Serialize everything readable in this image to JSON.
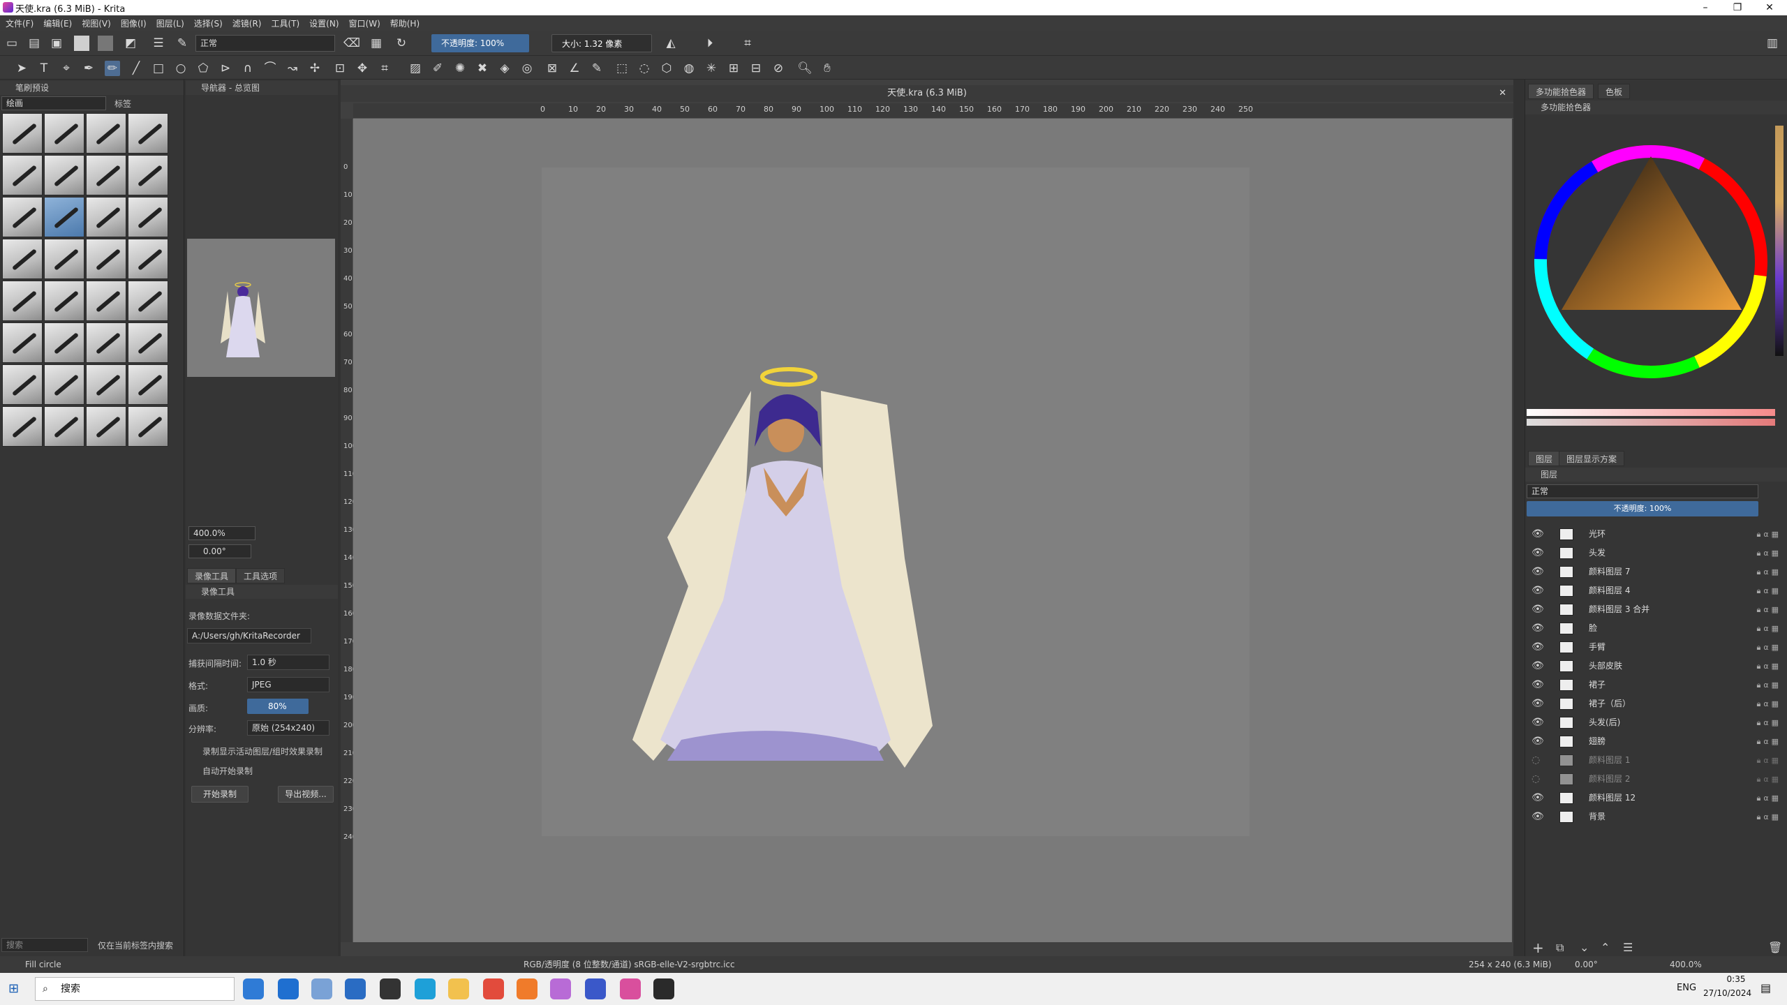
{
  "window": {
    "title": "天使.kra (6.3 MiB) - Krita"
  },
  "menu": [
    "文件(F)",
    "编辑(E)",
    "视图(V)",
    "图像(I)",
    "图层(L)",
    "选择(S)",
    "滤镜(R)",
    "工具(T)",
    "设置(N)",
    "窗口(W)",
    "帮助(H)"
  ],
  "toolbar": {
    "blend_mode": "正常",
    "opacity_label": "不透明度: 100%",
    "size_label": "大小: 1.32 像素"
  },
  "brush_presets": {
    "title": "笔刷预设",
    "filter": "绘画",
    "tag_label": "标签",
    "search_placeholder": "搜索",
    "search_in_tag": "仅在当前标签内搜索"
  },
  "navigator": {
    "title": "导航器 - 总览图",
    "zoom": "400.0%",
    "rotation": "0.00°"
  },
  "recorder": {
    "tabs": [
      "录像工具",
      "工具选项"
    ],
    "title": "录像工具",
    "folder_label": "录像数据文件夹:",
    "folder_value": "A:/Users/gh/KritaRecorder",
    "interval_label": "捕获间隔时间:",
    "interval_value": "1.0 秒",
    "format_label": "格式:",
    "format_value": "JPEG",
    "quality_label": "画质:",
    "quality_value": "80%",
    "resolution_label": "分辨率:",
    "resolution_value": "原始 (254x240)",
    "check1": "录制显示活动图层/组时效果录制",
    "check2": "自动开始录制",
    "start_button": "开始录制",
    "export_button": "导出视频..."
  },
  "canvas": {
    "tab_title": "天使.kra (6.3 MiB)",
    "ruler_h": [
      "0",
      "10",
      "20",
      "30",
      "40",
      "50",
      "60",
      "70",
      "80",
      "90",
      "100",
      "110",
      "120",
      "130",
      "140",
      "150",
      "160",
      "170",
      "180",
      "190",
      "200",
      "210",
      "220",
      "230",
      "240",
      "250"
    ],
    "ruler_v": [
      "0",
      "10",
      "20",
      "30",
      "40",
      "50",
      "60",
      "70",
      "80",
      "90",
      "100",
      "110",
      "120",
      "130",
      "140",
      "150",
      "160",
      "170",
      "180",
      "190",
      "200",
      "210",
      "220",
      "230",
      "240"
    ]
  },
  "color_docker": {
    "tabs": [
      "多功能拾色器",
      "色板"
    ],
    "title": "多功能拾色器"
  },
  "layers": {
    "tabs": [
      "图层",
      "图层显示方案"
    ],
    "title": "图层",
    "blend": "正常",
    "opacity": "不透明度: 100%",
    "items": [
      {
        "name": "光环",
        "visible": true
      },
      {
        "name": "头发",
        "visible": true
      },
      {
        "name": "颜料图层 7",
        "visible": true
      },
      {
        "name": "颜料图层 4",
        "visible": true
      },
      {
        "name": "颜料图层 3 合并",
        "visible": true
      },
      {
        "name": "脸",
        "visible": true
      },
      {
        "name": "手臂",
        "visible": true
      },
      {
        "name": "头部皮肤",
        "visible": true
      },
      {
        "name": "裙子",
        "visible": true
      },
      {
        "name": "裙子（后）",
        "visible": true
      },
      {
        "name": "头发(后)",
        "visible": true
      },
      {
        "name": "翅膀",
        "visible": true
      },
      {
        "name": "颜料图层 1",
        "visible": false
      },
      {
        "name": "颜料图层 2",
        "visible": false
      },
      {
        "name": "颜料图层 12",
        "visible": true
      },
      {
        "name": "背景",
        "visible": true
      }
    ]
  },
  "status": {
    "tool": "Fill circle",
    "colorspace": "RGB/透明度 (8 位整数/通道)  sRGB-elle-V2-srgbtrc.icc",
    "dims": "254 x 240 (6.3 MiB)",
    "rotation": "0.00°",
    "zoom": "400.0%"
  },
  "taskbar": {
    "search": "搜索",
    "lang": "ENG",
    "time": "0:35",
    "date": "27/10/2024"
  },
  "colors": {
    "accent": "#4e6d93",
    "bg": "#323232",
    "panel": "#353535"
  }
}
